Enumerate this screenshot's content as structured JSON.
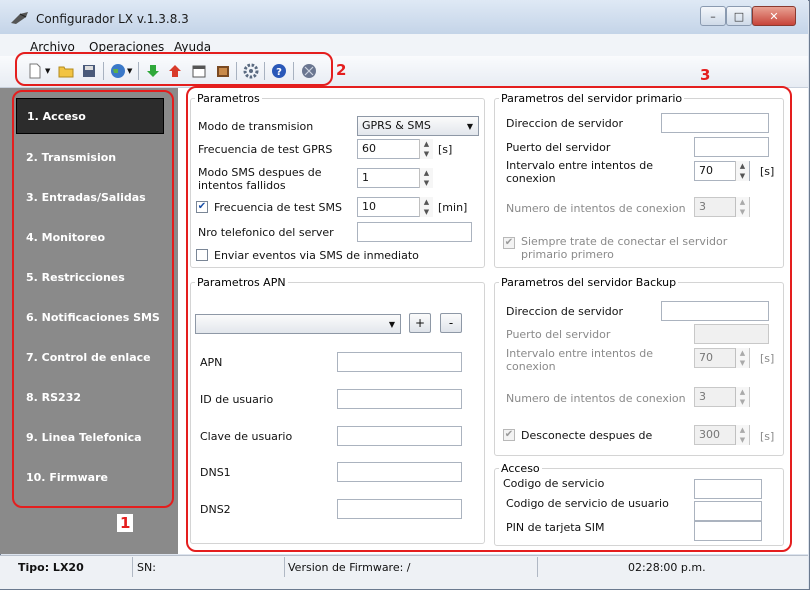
{
  "window": {
    "title": "Configurador LX v.1.3.8.3",
    "controls": {
      "minimize": "–",
      "maximize": "□",
      "close": "✕"
    }
  },
  "menu": {
    "items": [
      "Archivo",
      "Operaciones",
      "Ayuda"
    ]
  },
  "toolbar": {
    "icons": [
      "new-icon",
      "open-folder-icon",
      "save-icon",
      "globe-icon",
      "download-arrow-icon",
      "upload-arrow-icon",
      "calendar-icon",
      "book-icon",
      "gear-icon",
      "help-icon",
      "network-icon"
    ]
  },
  "sidebar": {
    "items": [
      {
        "label": "1. Acceso",
        "active": true
      },
      {
        "label": "2. Transmision"
      },
      {
        "label": "3. Entradas/Salidas"
      },
      {
        "label": "4. Monitoreo"
      },
      {
        "label": "5. Restricciones"
      },
      {
        "label": "6. Notificaciones SMS"
      },
      {
        "label": "7. Control de enlace"
      },
      {
        "label": "8. RS232"
      },
      {
        "label": "9. Linea Telefonica"
      },
      {
        "label": "10. Firmware"
      }
    ]
  },
  "annotations": {
    "one": "1",
    "two": "2",
    "three": "3"
  },
  "parametros": {
    "legend": "Parametros",
    "modo_label": "Modo de transmision",
    "modo_value": "GPRS & SMS",
    "freq_gprs_label": "Frecuencia de test GPRS",
    "freq_gprs_value": "60",
    "freq_gprs_unit": "[s]",
    "modo_sms_label": "Modo SMS despues de intentos fallidos",
    "modo_sms_value": "1",
    "freq_sms_label": "Frecuencia de test SMS",
    "freq_sms_value": "10",
    "freq_sms_unit": "[min]",
    "nro_tel_label": "Nro telefonico del server",
    "nro_tel_value": "",
    "enviar_label": "Enviar eventos via SMS de inmediato"
  },
  "apn": {
    "legend": "Parametros APN",
    "add_label": "+",
    "remove_label": "-",
    "apn_label": "APN",
    "id_label": "ID de usuario",
    "clave_label": "Clave de usuario",
    "dns1_label": "DNS1",
    "dns2_label": "DNS2"
  },
  "primario": {
    "legend": "Parametros del servidor primario",
    "direccion_label": "Direccion de servidor",
    "puerto_label": "Puerto del servidor",
    "intervalo_label": "Intervalo entre intentos de conexion",
    "intervalo_value": "70",
    "intervalo_unit": "[s]",
    "numero_label": "Numero de intentos de conexion",
    "numero_value": "3",
    "siempre_label": "Siempre trate de conectar el servidor primario primero"
  },
  "backup": {
    "legend": "Parametros del servidor Backup",
    "direccion_label": "Direccion de servidor",
    "puerto_label": "Puerto del servidor",
    "intervalo_label": "Intervalo entre intentos de conexion",
    "intervalo_value": "70",
    "intervalo_unit": "[s]",
    "numero_label": "Numero de intentos de conexion",
    "numero_value": "3",
    "desconecte_label": "Desconecte despues de",
    "desconecte_value": "300",
    "desconecte_unit": "[s]"
  },
  "acceso": {
    "legend": "Acceso",
    "codigo_label": "Codigo de servicio",
    "codigo_usuario_label": "Codigo de servicio de usuario",
    "pin_label": "PIN de tarjeta SIM"
  },
  "status": {
    "tipo": "Tipo: LX20",
    "sn": "SN:",
    "firmware": "Version de Firmware: /",
    "time": "02:28:00 p.m."
  },
  "colors": {
    "annotation": "#e41e1e",
    "sidebar_bg": "#8a8a8a",
    "active_item": "#2c2c2c"
  }
}
